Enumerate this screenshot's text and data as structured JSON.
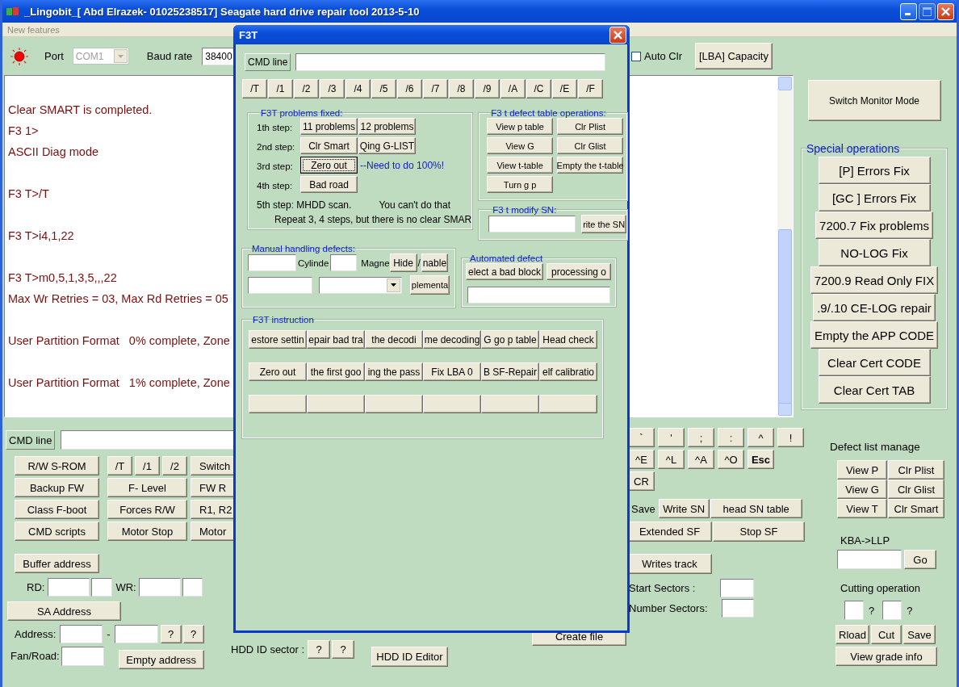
{
  "window": {
    "title": "_Lingobit_[ Abd Elrazek- 01025238517] Seagate hard drive repair tool 2013-5-10"
  },
  "menu": [
    "New features"
  ],
  "toolbar": {
    "port_label": "Port",
    "port": {
      "value": "COM1",
      "disabled": true
    },
    "baud_label": "Baud rate",
    "baud_value": "38400",
    "auto_clr": {
      "label": "Auto Clr",
      "checked": false
    },
    "capacity_button": "[LBA] Capacity"
  },
  "log": {
    "lines": [
      {
        "kind": "blank"
      },
      {
        "kind": "text",
        "text": "Clear SMART is completed."
      },
      {
        "kind": "text",
        "text": "F3 1>"
      },
      {
        "kind": "text",
        "text": "ASCII Diag mode"
      },
      {
        "kind": "blank"
      },
      {
        "kind": "text",
        "text": "F3 T>/T"
      },
      {
        "kind": "blank"
      },
      {
        "kind": "text",
        "text": "F3 T>i4,1,22"
      },
      {
        "kind": "blank"
      },
      {
        "kind": "text",
        "text": "F3 T>m0,5,1,3,5,,,22"
      },
      {
        "kind": "text",
        "text": "Max Wr Retries = 03, Max Rd Retries = 05"
      },
      {
        "kind": "blank"
      },
      {
        "kind": "text",
        "text": "User Partition Format   0% complete, Zone"
      },
      {
        "kind": "blank"
      },
      {
        "kind": "text",
        "text": "User Partition Format   1% complete, Zone"
      }
    ]
  },
  "side": {
    "monitor_button": "Switch Monitor  Mode",
    "special_title": "Special operations",
    "special_buttons": [
      "[P] Errors  Fix",
      "[GC ] Errors  Fix",
      "7200.7 Fix problems",
      "NO-LOG Fix",
      "7200.9 Read Only FIX",
      ".9/.10 CE-LOG repair",
      "Empty the APP CODE",
      "Clear Cert CODE",
      "Clear Cert TAB"
    ]
  },
  "lower_left": {
    "cmd_label": "CMD line",
    "command_rows": [
      {
        "first": "R/W S-ROM",
        "middle": [
          "/T",
          "/1",
          "/2"
        ],
        "last": "Switch"
      },
      {
        "first": "Backup FW",
        "middle": [
          "F- Level"
        ],
        "last": "FW R"
      },
      {
        "first": "Class F-boot",
        "middle": [
          "Forces R/W"
        ],
        "last": "R1, R2"
      },
      {
        "first": "CMD scripts",
        "middle": [
          "Motor Stop"
        ],
        "last": "Motor"
      }
    ],
    "buffer_address": "Buffer address",
    "rd_label": "RD:",
    "wr_label": "WR:",
    "sa_address": "SA Address",
    "address_label": "Address:",
    "dash": "-",
    "address_queries": [
      "?",
      "?"
    ],
    "fan_label": "Fan/Road:",
    "empty_address": "Empty address"
  },
  "lower_middle": {
    "create_file": "Create file",
    "hdd_id_label": "HDD ID sector :",
    "hdd_queries": [
      "?",
      "?"
    ],
    "hdd_editor": "HDD ID Editor"
  },
  "lower_right": {
    "key_rows": [
      [
        {
          "label": "`",
          "bold": false
        },
        {
          "label": "'",
          "bold": false
        },
        {
          "label": ";",
          "bold": false
        },
        {
          "label": ":",
          "bold": false
        },
        {
          "label": "^",
          "bold": false
        },
        {
          "label": "!",
          "bold": false
        }
      ],
      [
        {
          "label": "^E",
          "bold": false
        },
        {
          "label": "^L",
          "bold": false
        },
        {
          "label": "^A",
          "bold": false
        },
        {
          "label": "^O",
          "bold": false
        },
        {
          "label": "Esc",
          "bold": true
        }
      ],
      [
        {
          "label": "CR",
          "bold": false
        }
      ]
    ],
    "save_label": "Save",
    "write_sn": "Write SN",
    "head_sn_table": "head SN table",
    "extended_sf": "Extended SF",
    "stop_sf": "Stop SF",
    "writes_track": "Writes track",
    "start_sectors": "Start Sectors :",
    "number_sectors": "Number Sectors:"
  },
  "defect_list": {
    "title": "Defect list manage",
    "buttons": [
      [
        "View  P",
        "Clr Plist"
      ],
      [
        "View G",
        "Clr Glist"
      ],
      [
        "View T",
        "Clr Smart"
      ]
    ],
    "kba_label": "KBA->LLP",
    "go": "Go",
    "cutting_title": "Cutting operation",
    "cutting_marks": [
      "?",
      "?"
    ],
    "cutting_buttons": [
      "Rload",
      "Cut",
      "Save"
    ],
    "grade": "View grade info"
  },
  "dialog": {
    "title": "F3T",
    "cmd_label": "CMD line",
    "slash_buttons": [
      "/T",
      "/1",
      "/2",
      "/3",
      "/4",
      "/5",
      "/6",
      "/7",
      "/8",
      "/9",
      "/A",
      "/C",
      "/E",
      "/F"
    ],
    "problems": {
      "title": "F3T problems fixed:",
      "steps": [
        {
          "label": "1th step:",
          "buttons": [
            {
              "label": "11 problems",
              "focused": false
            },
            {
              "label": "12 problems",
              "focused": false
            }
          ]
        },
        {
          "label": "2nd step:",
          "buttons": [
            {
              "label": "Clr Smart",
              "focused": false
            },
            {
              "label": "Qing G-LIST",
              "focused": false
            }
          ]
        },
        {
          "label": "3rd step:",
          "buttons": [
            {
              "label": "Zero out",
              "focused": true
            }
          ],
          "note": "--Need to do 100%!"
        },
        {
          "label": "4th step:",
          "buttons": [
            {
              "label": "Bad road",
              "focused": false
            }
          ]
        }
      ],
      "step5": "5th step: MHDD scan.",
      "warning": "You can't do that",
      "repeat": "Repeat 3, 4 steps, but there is no clear SMAR"
    },
    "defect_ops": {
      "title": "F3 t defect table operations:",
      "buttons": [
        "View p table",
        "Clr Plist",
        "View G",
        "Clr Glist",
        "View t-table",
        "Empty the t-table",
        "Turn g p"
      ]
    },
    "modify_sn": {
      "title": "F3 t modify SN:",
      "button": "rite the SN"
    },
    "manual": {
      "title": "Manual handling defects:",
      "cylinder_label": "Cylinde",
      "magnet_label": "Magne",
      "hide": "Hide",
      "slash": "/",
      "enable": "nable",
      "implement": "plementa"
    },
    "automated": {
      "title": "Automated defect",
      "buttons": [
        "elect a bad block",
        "processing o"
      ]
    },
    "instruction": {
      "title": "F3T instruction",
      "rows": [
        [
          {
            "kind": "labeled",
            "label": "estore settin"
          },
          {
            "kind": "labeled",
            "label": "epair bad tra"
          },
          {
            "kind": "labeled",
            "label": "the decodi"
          },
          {
            "kind": "labeled",
            "label": "me decoding"
          },
          {
            "kind": "labeled",
            "label": "G go p table"
          },
          {
            "kind": "labeled",
            "label": "Head check"
          }
        ],
        [
          {
            "kind": "labeled",
            "label": "Zero out"
          },
          {
            "kind": "labeled",
            "label": "the first goo"
          },
          {
            "kind": "labeled",
            "label": "ing the pass"
          },
          {
            "kind": "labeled",
            "label": "Fix LBA 0"
          },
          {
            "kind": "labeled",
            "label": "B SF-Repair"
          },
          {
            "kind": "labeled",
            "label": "elf calibratio"
          }
        ],
        [
          {
            "kind": "blank"
          },
          {
            "kind": "blank"
          },
          {
            "kind": "blank"
          },
          {
            "kind": "blank"
          },
          {
            "kind": "blank"
          },
          {
            "kind": "blank"
          }
        ]
      ]
    }
  }
}
